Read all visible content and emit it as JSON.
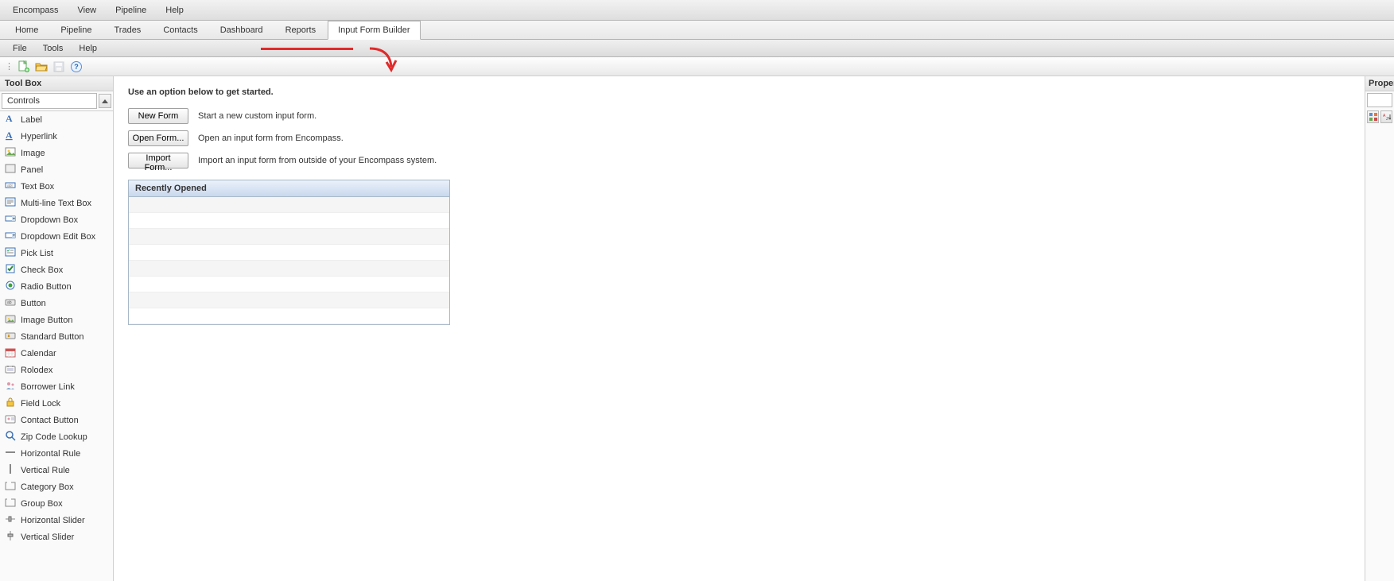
{
  "menubar": [
    "Encompass",
    "View",
    "Pipeline",
    "Help"
  ],
  "tabs": [
    {
      "label": "Home",
      "active": false
    },
    {
      "label": "Pipeline",
      "active": false
    },
    {
      "label": "Trades",
      "active": false
    },
    {
      "label": "Contacts",
      "active": false
    },
    {
      "label": "Dashboard",
      "active": false
    },
    {
      "label": "Reports",
      "active": false
    },
    {
      "label": "Input Form Builder",
      "active": true
    }
  ],
  "subMenubar": [
    "File",
    "Tools",
    "Help"
  ],
  "iconbarIcons": [
    "new-file-icon",
    "open-folder-icon",
    "save-icon",
    "help-icon"
  ],
  "toolbox": {
    "title": "Tool Box",
    "selector": "Controls",
    "items": [
      {
        "icon": "label-icon",
        "label": "Label"
      },
      {
        "icon": "hyperlink-icon",
        "label": "Hyperlink"
      },
      {
        "icon": "image-icon",
        "label": "Image"
      },
      {
        "icon": "panel-icon",
        "label": "Panel"
      },
      {
        "icon": "textbox-icon",
        "label": "Text Box"
      },
      {
        "icon": "multiline-textbox-icon",
        "label": "Multi-line Text Box"
      },
      {
        "icon": "dropdown-box-icon",
        "label": "Dropdown Box"
      },
      {
        "icon": "dropdown-edit-box-icon",
        "label": "Dropdown Edit Box"
      },
      {
        "icon": "picklist-icon",
        "label": "Pick List"
      },
      {
        "icon": "checkbox-icon",
        "label": "Check Box"
      },
      {
        "icon": "radio-icon",
        "label": "Radio Button"
      },
      {
        "icon": "button-icon",
        "label": "Button"
      },
      {
        "icon": "image-button-icon",
        "label": "Image Button"
      },
      {
        "icon": "standard-button-icon",
        "label": "Standard Button"
      },
      {
        "icon": "calendar-icon",
        "label": "Calendar"
      },
      {
        "icon": "rolodex-icon",
        "label": "Rolodex"
      },
      {
        "icon": "borrower-link-icon",
        "label": "Borrower Link"
      },
      {
        "icon": "field-lock-icon",
        "label": "Field Lock"
      },
      {
        "icon": "contact-button-icon",
        "label": "Contact Button"
      },
      {
        "icon": "zipcode-lookup-icon",
        "label": "Zip Code Lookup"
      },
      {
        "icon": "hrule-icon",
        "label": "Horizontal Rule"
      },
      {
        "icon": "vrule-icon",
        "label": "Vertical Rule"
      },
      {
        "icon": "category-box-icon",
        "label": "Category Box"
      },
      {
        "icon": "group-box-icon",
        "label": "Group Box"
      },
      {
        "icon": "hslider-icon",
        "label": "Horizontal Slider"
      },
      {
        "icon": "vslider-icon",
        "label": "Vertical Slider"
      }
    ]
  },
  "main": {
    "heading": "Use an option below to get started.",
    "options": [
      {
        "button": "New Form",
        "desc": "Start a new custom input form."
      },
      {
        "button": "Open Form...",
        "desc": "Open an input form from Encompass."
      },
      {
        "button": "Import Form...",
        "desc": "Import an input form from outside of your Encompass system."
      }
    ],
    "recentHeader": "Recently Opened",
    "recentRows": 8
  },
  "properties": {
    "title": "Properti"
  }
}
